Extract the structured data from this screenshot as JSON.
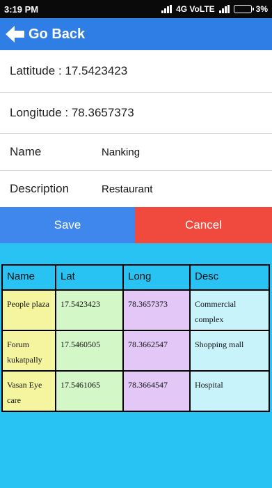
{
  "status_bar": {
    "time": "3:19 PM",
    "network": "4G VoLTE",
    "battery": "3%"
  },
  "header": {
    "back_label": "Go Back"
  },
  "details": {
    "latitude": "Lattitude : 17.5423423",
    "longitude": "Longitude : 78.3657373",
    "name_label": "Name",
    "name_value": "Nanking",
    "description_label": "Description",
    "description_value": "Restaurant"
  },
  "actions": {
    "save": "Save",
    "cancel": "Cancel"
  },
  "table": {
    "headers": [
      "Name",
      "Lat",
      "Long",
      "Desc"
    ],
    "rows": [
      [
        "People plaza",
        "17.5423423",
        "78.3657373",
        "Commercial complex"
      ],
      [
        "Forum kukatpally",
        "17.5460505",
        "78.3662547",
        "Shopping mall"
      ],
      [
        "Vasan Eye care",
        "17.5461065",
        "78.3664547",
        "Hospital"
      ]
    ]
  },
  "colors": {
    "app_bar": "#2f7ee6",
    "save": "#3f87ec",
    "cancel": "#ef4a3d",
    "background": "#29c3f3"
  }
}
